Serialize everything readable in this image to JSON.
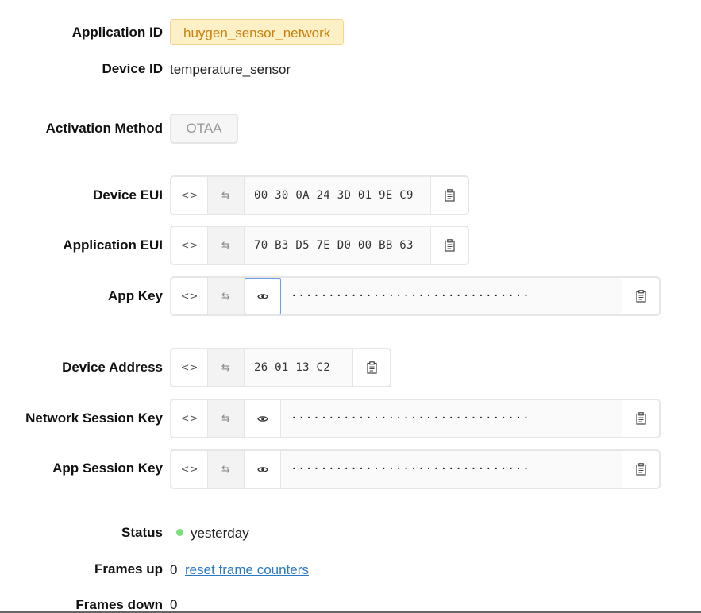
{
  "labels": {
    "application_id": "Application ID",
    "device_id": "Device ID",
    "activation_method": "Activation Method",
    "device_eui": "Device EUI",
    "application_eui": "Application EUI",
    "app_key": "App Key",
    "device_address": "Device Address",
    "network_session_key": "Network Session Key",
    "app_session_key": "App Session Key",
    "status": "Status",
    "frames_up": "Frames up",
    "frames_down": "Frames down"
  },
  "values": {
    "application_id": "huygen_sensor_network",
    "device_id": "temperature_sensor",
    "activation_method": "OTAA",
    "device_eui": "00 30 0A 24 3D 01 9E C9",
    "application_eui": "70 B3 D5 7E D0 00 BB 63",
    "app_key_masked": "································",
    "device_address": "26 01 13 C2",
    "network_session_key_masked": "································",
    "app_session_key_masked": "································",
    "status": "yesterday",
    "frames_up": "0",
    "frames_down": "0",
    "reset_link": "reset frame counters"
  },
  "icons": {
    "toggle_format": "<>",
    "swap_byte_order": "⇆",
    "reveal": "eye-icon",
    "copy": "clipboard-icon"
  },
  "colors": {
    "app_badge_bg": "#fdefc6",
    "app_badge_text": "#c9820e",
    "status_dot": "#7be07b",
    "link": "#2a7bc4",
    "focus_border": "#6f9fe3"
  }
}
